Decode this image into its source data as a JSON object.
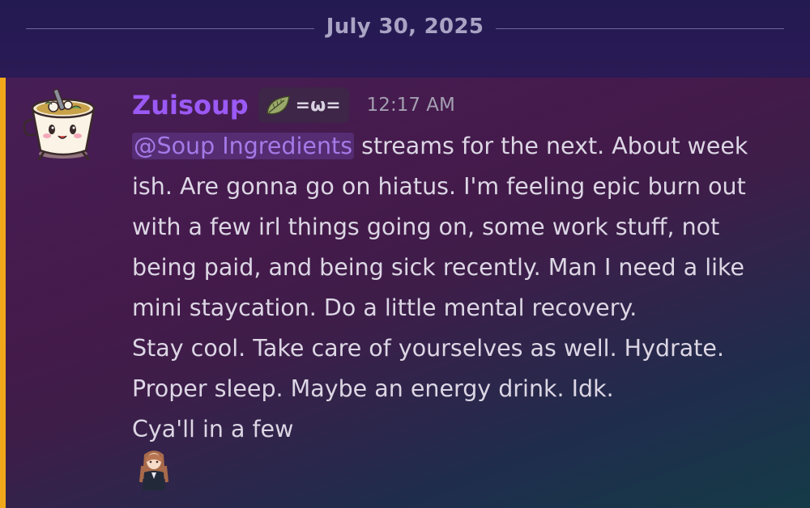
{
  "date_divider": {
    "label": "July 30, 2025"
  },
  "message": {
    "author": "Zuisoup",
    "role_tag": {
      "icon": "leaf-icon",
      "label": "=ω="
    },
    "timestamp": "12:17 AM",
    "mention": "@Soup Ingredients",
    "lines": [
      " streams for the next. About week",
      "ish. Are gonna go on hiatus. I'm feeling epic burn out",
      "with a few irl things going on, some work stuff, not",
      "being paid, and being sick recently. Man I need a like",
      "mini staycation. Do a little mental recovery.",
      "Stay cool. Take care of yourselves as well. Hydrate.",
      "Proper sleep. Maybe an energy drink. Idk.",
      "Cya'll in a few"
    ],
    "sticker": "anime-girl-emoji"
  },
  "colors": {
    "username": "#9b59f5",
    "mention_bar": "#f0a81a",
    "mention_text": "#a47ae8"
  }
}
